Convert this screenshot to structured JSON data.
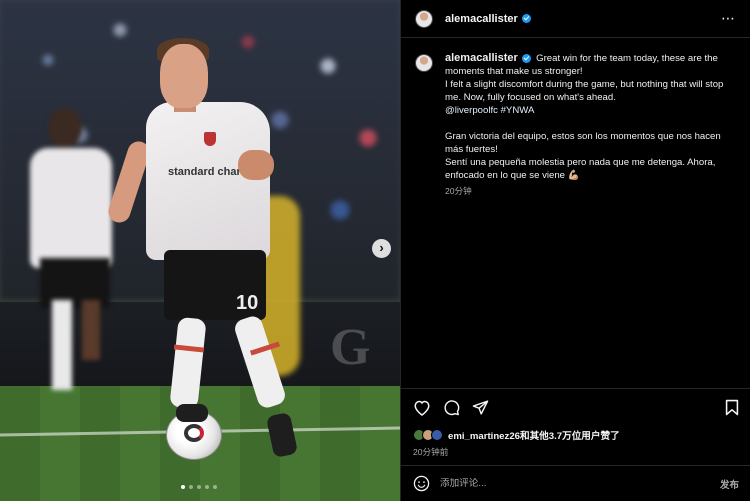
{
  "post": {
    "username": "alemacallister",
    "caption_en_1": "Great win for the team today, these are the moments that make us stronger!",
    "caption_en_2": "I felt a slight discomfort during the game, but nothing that will stop me. Now, fully focused on what's ahead.",
    "caption_tags": "@liverpoolfc #YNWA",
    "caption_es_1": "Gran victoria del equipo, estos son los momentos que nos hacen más fuertes!",
    "caption_es_2": "Sentí una pequeña molestia pero nada que me detenga. Ahora, enfocado en lo que se viene 💪🏼",
    "time": "20分钟"
  },
  "image": {
    "shirt_sponsor": "standard chartered",
    "shirt_number": "10",
    "board_text": "G",
    "carousel": {
      "count": 5,
      "active": 1
    }
  },
  "likes": {
    "text": "emi_martinez26和其他3.7万位用户赞了",
    "time": "20分钟前"
  },
  "comment": {
    "placeholder": "添加评论...",
    "publish_label": "发布"
  },
  "colors": {
    "background": "#000000",
    "verified": "#1d9bf0",
    "muted_text": "#a8a8a8"
  },
  "icons": [
    "verified-icon",
    "more-icon",
    "next-icon",
    "heart-icon",
    "comment-icon",
    "share-icon",
    "bookmark-icon",
    "emoji-icon"
  ]
}
